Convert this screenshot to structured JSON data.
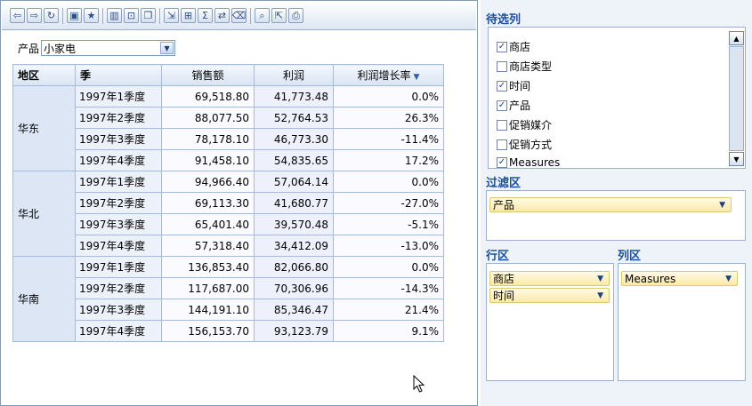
{
  "filter": {
    "label": "产品",
    "value": "小家电"
  },
  "toolbar_icons": [
    "arrow-left-icon",
    "arrow-right-icon",
    "refresh-icon",
    "sep",
    "save-icon",
    "star-icon",
    "sep",
    "bar-chart-icon",
    "zoom-frame-icon",
    "copy-icon",
    "sep",
    "export-icon",
    "drill-icon",
    "sum-icon",
    "swap-icon",
    "clear-icon",
    "sep",
    "search-icon",
    "import-icon",
    "print-icon"
  ],
  "table": {
    "headers": {
      "region": "地区",
      "quarter": "季",
      "sales": "销售额",
      "profit": "利润",
      "growth": "利润增长率"
    },
    "groups": [
      {
        "region": "华东",
        "rows": [
          {
            "quarter": "1997年1季度",
            "sales": "69,518.80",
            "profit": "41,773.48",
            "growth": "0.0%"
          },
          {
            "quarter": "1997年2季度",
            "sales": "88,077.50",
            "profit": "52,764.53",
            "growth": "26.3%"
          },
          {
            "quarter": "1997年3季度",
            "sales": "78,178.10",
            "profit": "46,773.30",
            "growth": "-11.4%"
          },
          {
            "quarter": "1997年4季度",
            "sales": "91,458.10",
            "profit": "54,835.65",
            "growth": "17.2%"
          }
        ]
      },
      {
        "region": "华北",
        "rows": [
          {
            "quarter": "1997年1季度",
            "sales": "94,966.40",
            "profit": "57,064.14",
            "growth": "0.0%"
          },
          {
            "quarter": "1997年2季度",
            "sales": "69,113.30",
            "profit": "41,680.77",
            "growth": "-27.0%"
          },
          {
            "quarter": "1997年3季度",
            "sales": "65,401.40",
            "profit": "39,570.48",
            "growth": "-5.1%"
          },
          {
            "quarter": "1997年4季度",
            "sales": "57,318.40",
            "profit": "34,412.09",
            "growth": "-13.0%"
          }
        ]
      },
      {
        "region": "华南",
        "rows": [
          {
            "quarter": "1997年1季度",
            "sales": "136,853.40",
            "profit": "82,066.80",
            "growth": "0.0%"
          },
          {
            "quarter": "1997年2季度",
            "sales": "117,687.00",
            "profit": "70,306.96",
            "growth": "-14.3%"
          },
          {
            "quarter": "1997年3季度",
            "sales": "144,191.10",
            "profit": "85,346.47",
            "growth": "21.4%"
          },
          {
            "quarter": "1997年4季度",
            "sales": "156,153.70",
            "profit": "93,123.79",
            "growth": "9.1%"
          }
        ]
      }
    ]
  },
  "panel": {
    "available_title": "待选列",
    "fields": [
      {
        "label": "商店",
        "checked": true
      },
      {
        "label": "商店类型",
        "checked": false
      },
      {
        "label": "时间",
        "checked": true
      },
      {
        "label": "产品",
        "checked": true
      },
      {
        "label": "促销媒介",
        "checked": false
      },
      {
        "label": "促销方式",
        "checked": false
      },
      {
        "label": "Measures",
        "checked": true
      }
    ],
    "filter_zone_title": "过滤区",
    "filter_chips": [
      "产品"
    ],
    "row_zone_title": "行区",
    "row_chips": [
      "商店",
      "时间"
    ],
    "col_zone_title": "列区",
    "col_chips": [
      "Measures"
    ]
  },
  "colors": {
    "accent": "#1b4f9c",
    "chip_fill": "#fbe9a6",
    "header_fill": "#d9e4f3"
  }
}
